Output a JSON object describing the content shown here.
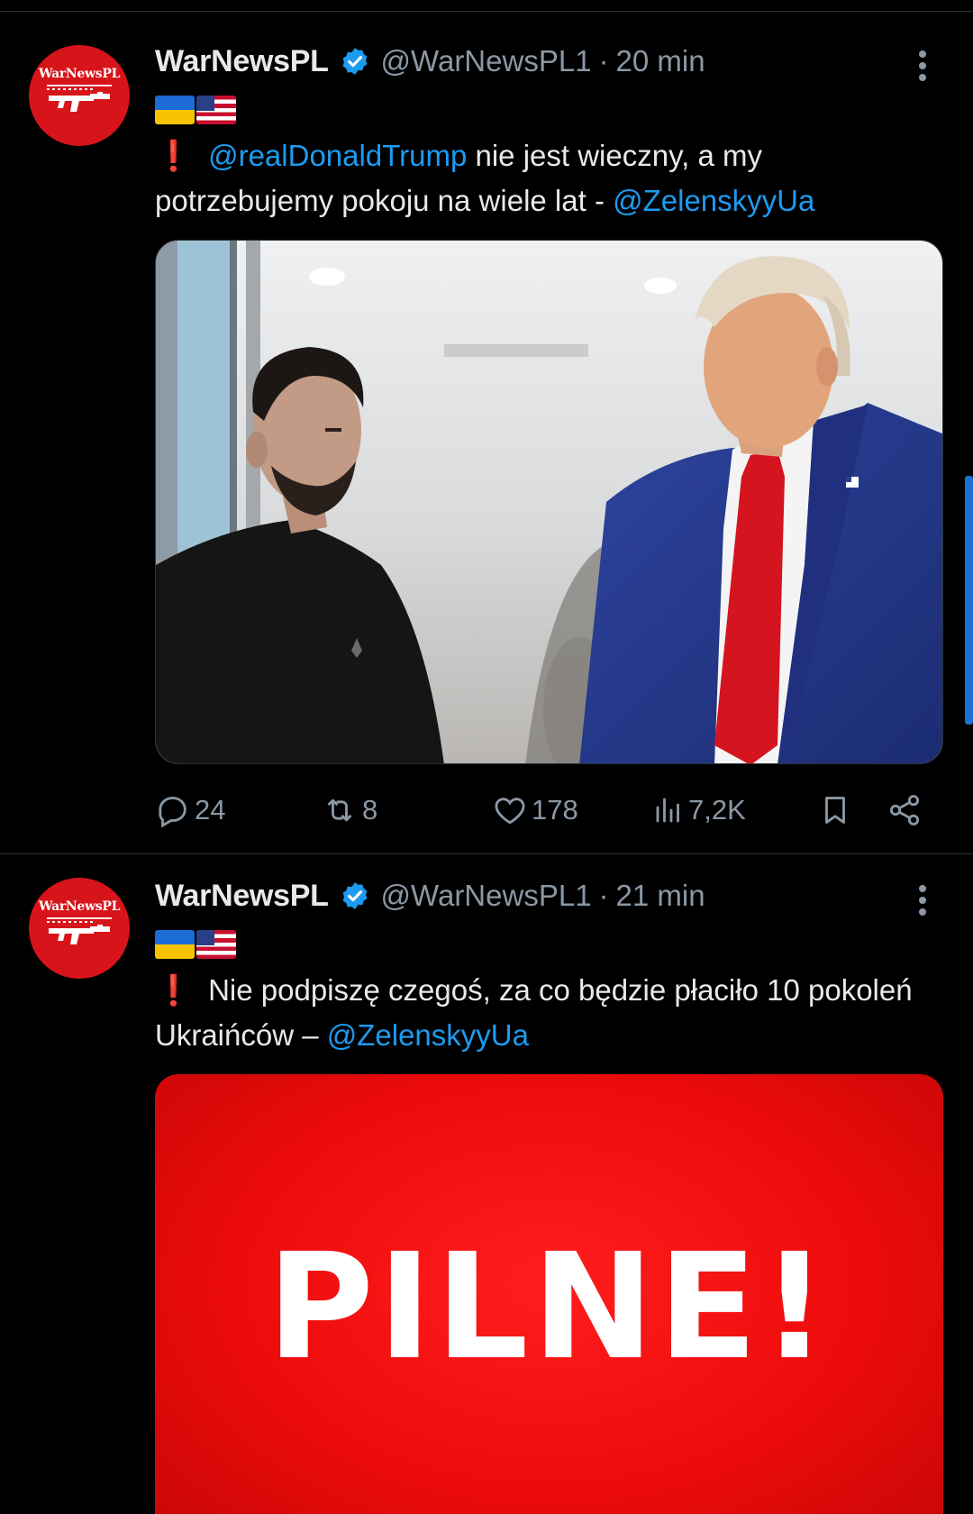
{
  "tweets": [
    {
      "author": {
        "name": "WarNewsPL",
        "handle": "@WarNewsPL1",
        "avatar_text": "WarNewsPL",
        "verified": true
      },
      "time": "20 min",
      "flags": [
        "flag-ua-icon",
        "flag-us-icon"
      ],
      "text": {
        "alert_icon": "❗",
        "mention_1": "@realDonaldTrump",
        "segment_1": " nie jest wieczny, a my potrzebujemy pokoju na wiele lat - ",
        "mention_2": "@ZelenskyyUa"
      },
      "media": {
        "type": "photo"
      },
      "stats": {
        "replies": "24",
        "reposts": "8",
        "likes": "178",
        "views": "7,2K"
      }
    },
    {
      "author": {
        "name": "WarNewsPL",
        "handle": "@WarNewsPL1",
        "avatar_text": "WarNewsPL",
        "verified": true
      },
      "time": "21 min",
      "flags": [
        "flag-ua-icon",
        "flag-us-icon"
      ],
      "text": {
        "alert_icon": "❗",
        "segment_1": "Nie podpiszę czegoś, za co będzie płaciło 10 pokoleń Ukraińców – ",
        "mention_1": "@ZelenskyyUa"
      },
      "media": {
        "type": "graphic",
        "headline": "PILNE!"
      }
    }
  ],
  "colors": {
    "background": "#000000",
    "primary_text": "#e7e9ea",
    "secondary_text": "#8b98a5",
    "link": "#1d9bf0",
    "verified": "#1d9bf0",
    "alert_red": "#e0202a",
    "avatar_red": "#d8141b",
    "breaking_red": "#ee0b0b"
  }
}
